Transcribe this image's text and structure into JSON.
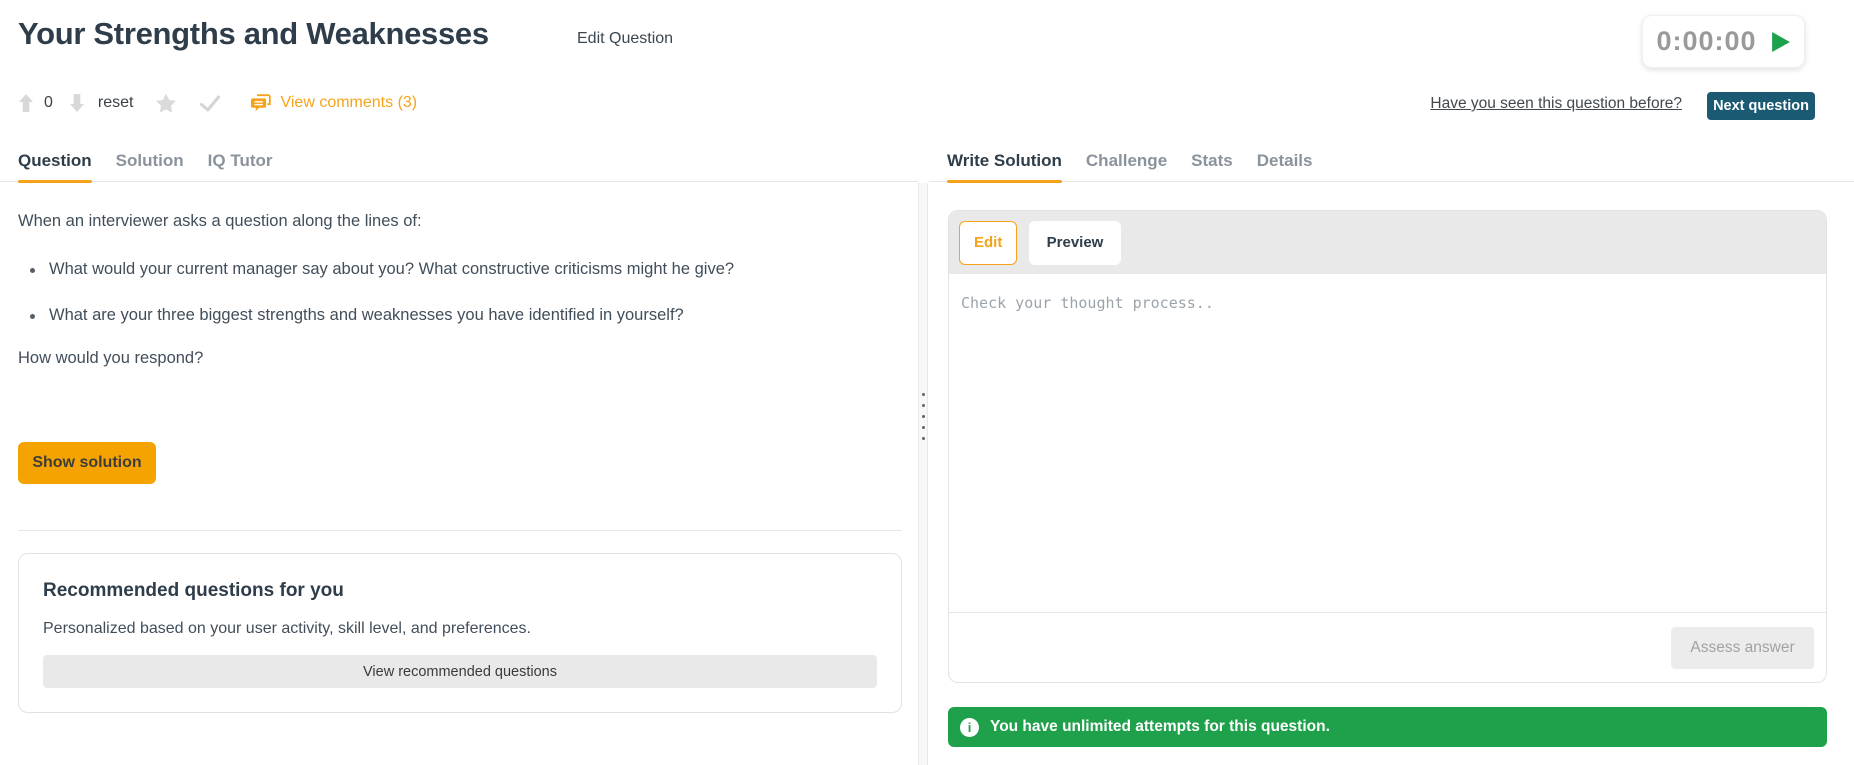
{
  "header": {
    "title": "Your Strengths and Weaknesses",
    "edit_question": "Edit Question",
    "timer": "0:00:00",
    "seen_before_link": "Have you seen this question before?",
    "next_question": "Next question"
  },
  "vote_bar": {
    "score": "0",
    "reset_label": "reset",
    "view_comments": "View comments (3)"
  },
  "left_tabs": [
    {
      "label": "Question",
      "active": true
    },
    {
      "label": "Solution",
      "active": false
    },
    {
      "label": "IQ Tutor",
      "active": false
    }
  ],
  "right_tabs": [
    {
      "label": "Write Solution",
      "active": true
    },
    {
      "label": "Challenge",
      "active": false
    },
    {
      "label": "Stats",
      "active": false
    },
    {
      "label": "Details",
      "active": false
    }
  ],
  "question": {
    "intro": "When an interviewer asks a question along the lines of:",
    "bullets": [
      "What would your current manager say about you? What constructive criticisms might he give?",
      "What are your three biggest strengths and weaknesses you have identified in yourself?"
    ],
    "outro": "How would you respond?",
    "show_solution": "Show solution"
  },
  "recommended": {
    "title": "Recommended questions for you",
    "subtitle": "Personalized based on your user activity, skill level, and preferences.",
    "button": "View recommended questions"
  },
  "editor": {
    "edit_tab": "Edit",
    "preview_tab": "Preview",
    "placeholder": "Check your thought process..",
    "assess_button": "Assess answer"
  },
  "banner": {
    "info_glyph": "i",
    "text": "You have unlimited attempts for this question."
  },
  "icons": {
    "upvote": "arrow-up-icon",
    "downvote": "arrow-down-icon",
    "favorite": "star-icon",
    "mark_done": "check-icon",
    "comments": "comment-bubbles-icon",
    "timer_start": "play-icon",
    "banner_info": "info-icon",
    "panel_resize": "drag-dots-icon"
  },
  "colors": {
    "accent_orange": "#f5a31b",
    "button_orange": "#f5a300",
    "success_green": "#1fa14b",
    "teal_button": "#1a5a73",
    "dark_slate": "#2e3d49",
    "muted_gray": "#8a939b"
  }
}
